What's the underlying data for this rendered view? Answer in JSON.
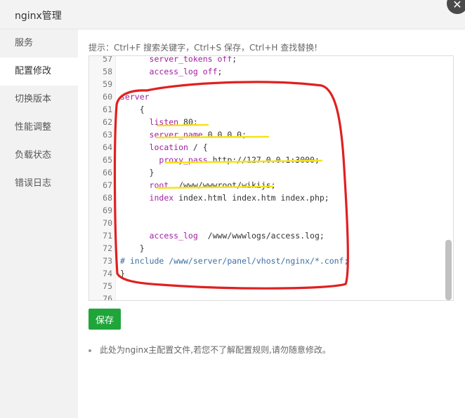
{
  "window": {
    "title": "nginx管理",
    "close_glyph": "✕"
  },
  "sidebar": {
    "items": [
      {
        "label": "服务",
        "active": false
      },
      {
        "label": "配置修改",
        "active": true
      },
      {
        "label": "切换版本",
        "active": false
      },
      {
        "label": "性能调整",
        "active": false
      },
      {
        "label": "负载状态",
        "active": false
      },
      {
        "label": "错误日志",
        "active": false
      }
    ]
  },
  "hint": "提示：Ctrl+F 搜索关键字，Ctrl+S 保存，Ctrl+H 查找替换!",
  "editor": {
    "lines": [
      {
        "num": "57",
        "code": "      server_tokens off;"
      },
      {
        "num": "58",
        "code": "      access_log off;"
      },
      {
        "num": "59",
        "code": ""
      },
      {
        "num": "60",
        "code": "server"
      },
      {
        "num": "61",
        "code": "    {"
      },
      {
        "num": "62",
        "code": "      listen 80;"
      },
      {
        "num": "63",
        "code": "      server_name 0.0.0.0;"
      },
      {
        "num": "64",
        "code": "      location / {"
      },
      {
        "num": "65",
        "code": "        proxy_pass http://127.0.0.1:3000;"
      },
      {
        "num": "66",
        "code": "      }"
      },
      {
        "num": "67",
        "code": "      root  /www/wwwroot/wikijs;"
      },
      {
        "num": "68",
        "code": "      index index.html index.htm index.php;"
      },
      {
        "num": "69",
        "code": ""
      },
      {
        "num": "70",
        "code": ""
      },
      {
        "num": "71",
        "code": "      access_log  /www/wwwlogs/access.log;"
      },
      {
        "num": "72",
        "code": "    }"
      },
      {
        "num": "73",
        "code": "# include /www/server/panel/vhost/nginx/*.conf;"
      },
      {
        "num": "74",
        "code": "}"
      },
      {
        "num": "75",
        "code": ""
      },
      {
        "num": "76",
        "code": ""
      }
    ]
  },
  "save_label": "保存",
  "note": "此处为nginx主配置文件,若您不了解配置规则,请勿随意修改。",
  "colors": {
    "accent_green": "#20a53a",
    "annotation_red": "#e02020",
    "annotation_yellow": "#f5e31a"
  }
}
